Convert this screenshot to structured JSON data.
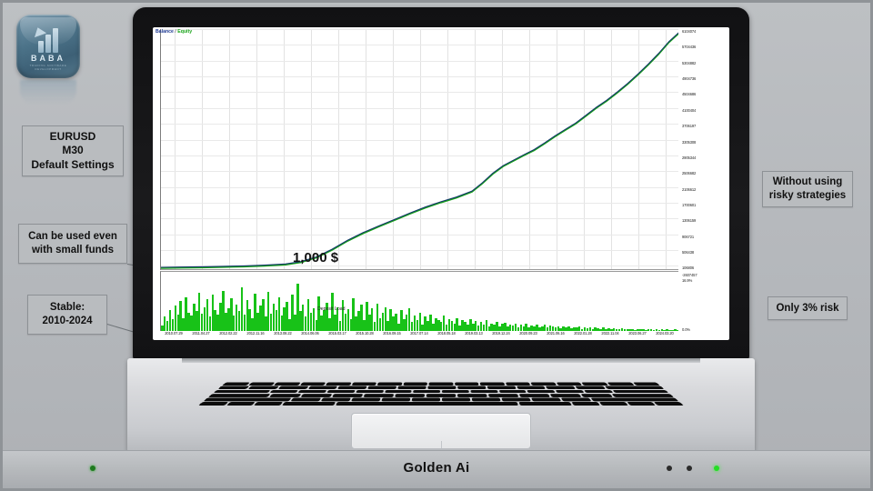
{
  "brand": {
    "logo_name": "BABA",
    "logo_subtitle": "TRADING SOFTWARE DEVELOPMENT",
    "product_name": "Golden Ai"
  },
  "callouts": {
    "pair": [
      "EURUSD",
      "M30",
      "Default Settings"
    ],
    "small_funds": [
      "Can be used even",
      "with small funds"
    ],
    "stable": [
      "Stable:",
      "2010-2024"
    ],
    "risky": [
      "Without using",
      "risky strategies"
    ],
    "risk": [
      "Only 3% risk"
    ]
  },
  "chart_data": {
    "type": "line",
    "title": "Balance / Equity",
    "legend": [
      "Balance",
      "Equity"
    ],
    "legend_colors": [
      "#1f3a93",
      "#17a317"
    ],
    "deposit_label": "1,000 $",
    "subpanel_title": "Deposit Load",
    "xlabel": "",
    "ylabel": "",
    "grid": true,
    "ylim": [
      0,
      6104074
    ],
    "y_ticks": [
      "6104074",
      "5704436",
      "5304882",
      "4904736",
      "4504686",
      "4100404",
      "3706197",
      "3305308",
      "2905344",
      "2506682",
      "2106612",
      "1700601",
      "1306159",
      "906721",
      "506438",
      "106806"
    ],
    "y_ticks_values": [
      6104074,
      5704436,
      5304882,
      4904736,
      4504686,
      4100404,
      3706197,
      3305308,
      2905344,
      2506682,
      2106612,
      1700601,
      1306159,
      906721,
      506438,
      106806
    ],
    "load_ticks": [
      "-2607457",
      "16.9%",
      "0.0%"
    ],
    "x_ticks": [
      "2010.07.29",
      "2011.04.27",
      "2012.02.22",
      "2012.11.16",
      "2013.08.22",
      "2014.06.06",
      "2015.03.17",
      "2015.10.28",
      "2016.09.15",
      "2017.07.14",
      "2018.05.18",
      "2019.03.13",
      "2019.12.24",
      "2020.09.23",
      "2021.06.16",
      "2022.01.28",
      "2022.11.04",
      "2023.06.27",
      "2024.03.20"
    ],
    "balance_curve": [
      [
        0.0,
        0.004
      ],
      [
        0.04,
        0.005
      ],
      [
        0.08,
        0.006
      ],
      [
        0.12,
        0.008
      ],
      [
        0.16,
        0.01
      ],
      [
        0.2,
        0.013
      ],
      [
        0.24,
        0.018
      ],
      [
        0.27,
        0.028
      ],
      [
        0.3,
        0.048
      ],
      [
        0.33,
        0.08
      ],
      [
        0.36,
        0.118
      ],
      [
        0.39,
        0.15
      ],
      [
        0.42,
        0.178
      ],
      [
        0.45,
        0.205
      ],
      [
        0.48,
        0.232
      ],
      [
        0.51,
        0.258
      ],
      [
        0.54,
        0.28
      ],
      [
        0.57,
        0.3
      ],
      [
        0.6,
        0.325
      ],
      [
        0.62,
        0.36
      ],
      [
        0.64,
        0.4
      ],
      [
        0.66,
        0.432
      ],
      [
        0.68,
        0.455
      ],
      [
        0.7,
        0.478
      ],
      [
        0.72,
        0.5
      ],
      [
        0.74,
        0.528
      ],
      [
        0.76,
        0.558
      ],
      [
        0.78,
        0.585
      ],
      [
        0.8,
        0.612
      ],
      [
        0.82,
        0.645
      ],
      [
        0.84,
        0.678
      ],
      [
        0.86,
        0.708
      ],
      [
        0.88,
        0.742
      ],
      [
        0.9,
        0.778
      ],
      [
        0.92,
        0.818
      ],
      [
        0.94,
        0.86
      ],
      [
        0.96,
        0.905
      ],
      [
        0.98,
        0.955
      ],
      [
        1.0,
        0.995
      ]
    ],
    "deposit_load_bars": [
      0.1,
      0.26,
      0.18,
      0.38,
      0.22,
      0.46,
      0.3,
      0.55,
      0.24,
      0.62,
      0.34,
      0.28,
      0.5,
      0.36,
      0.7,
      0.32,
      0.44,
      0.58,
      0.26,
      0.66,
      0.38,
      0.3,
      0.52,
      0.74,
      0.34,
      0.42,
      0.6,
      0.28,
      0.48,
      0.36,
      0.8,
      0.3,
      0.56,
      0.4,
      0.24,
      0.68,
      0.34,
      0.46,
      0.58,
      0.26,
      0.72,
      0.32,
      0.5,
      0.38,
      0.62,
      0.28,
      0.44,
      0.54,
      0.22,
      0.66,
      0.3,
      0.86,
      0.36,
      0.48,
      0.26,
      0.58,
      0.34,
      0.42,
      0.2,
      0.64,
      0.28,
      0.38,
      0.52,
      0.24,
      0.7,
      0.3,
      0.44,
      0.18,
      0.56,
      0.32,
      0.4,
      0.22,
      0.6,
      0.26,
      0.36,
      0.48,
      0.2,
      0.54,
      0.3,
      0.42,
      0.16,
      0.5,
      0.24,
      0.34,
      0.44,
      0.18,
      0.4,
      0.26,
      0.32,
      0.14,
      0.38,
      0.22,
      0.3,
      0.42,
      0.16,
      0.28,
      0.2,
      0.34,
      0.12,
      0.26,
      0.18,
      0.3,
      0.14,
      0.24,
      0.2,
      0.16,
      0.28,
      0.12,
      0.22,
      0.18,
      0.14,
      0.24,
      0.1,
      0.2,
      0.16,
      0.12,
      0.22,
      0.14,
      0.18,
      0.1,
      0.16,
      0.12,
      0.2,
      0.08,
      0.14,
      0.11,
      0.17,
      0.09,
      0.13,
      0.15,
      0.08,
      0.12,
      0.1,
      0.14,
      0.07,
      0.11,
      0.09,
      0.13,
      0.06,
      0.1,
      0.08,
      0.12,
      0.07,
      0.09,
      0.11,
      0.06,
      0.1,
      0.08,
      0.07,
      0.09,
      0.05,
      0.08,
      0.06,
      0.09,
      0.05,
      0.07,
      0.06,
      0.08,
      0.04,
      0.07,
      0.05,
      0.06,
      0.04,
      0.06,
      0.05,
      0.04,
      0.06,
      0.03,
      0.05,
      0.04,
      0.05,
      0.03,
      0.04,
      0.05,
      0.03,
      0.04,
      0.03,
      0.04,
      0.02,
      0.04,
      0.03,
      0.03,
      0.02,
      0.03,
      0.04,
      0.02,
      0.03,
      0.02,
      0.03,
      0.02,
      0.03,
      0.02,
      0.02,
      0.03,
      0.02
    ]
  }
}
